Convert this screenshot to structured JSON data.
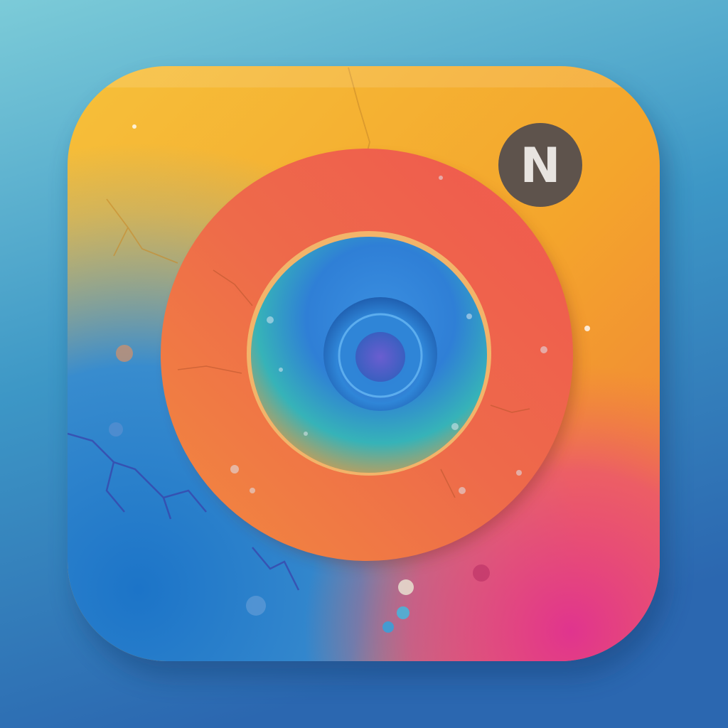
{
  "app_icon": {
    "badge": {
      "letter": "N",
      "fill": "#5e534c",
      "text_color": "#e8e4e0"
    },
    "colors": {
      "background_top": "#7cc8d6",
      "background_bottom": "#2a6fb8",
      "tile_yellow": "#f7b731",
      "tile_orange": "#f39a2c",
      "tile_blue": "#1f7fd1",
      "tile_pink": "#e8358a",
      "ring_orange": "#f07a45",
      "ring_red": "#ec5a55",
      "lens_blue": "#2f8fe0",
      "lens_teal": "#34c3b0",
      "lens_orange": "#e98b3f",
      "pupil_outer": "#4aa0e8",
      "pupil_inner": "#5058c8"
    }
  }
}
